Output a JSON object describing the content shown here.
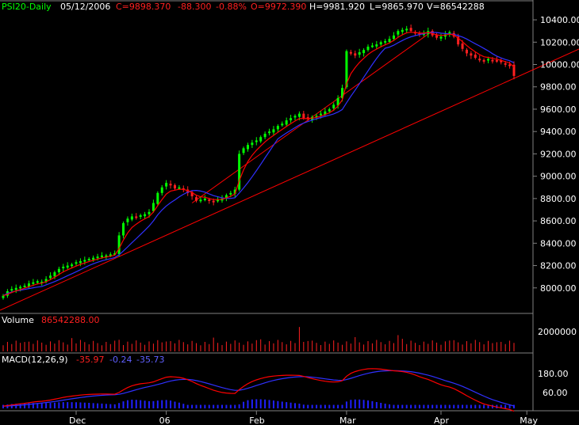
{
  "header": {
    "symbol": "PSI20-Daily",
    "date": "05/12/2006",
    "close": "C=9898.370",
    "change": "-88.300",
    "change_pct": "-0.88%",
    "open": "O=9972.390",
    "high": "H=9981.920",
    "low": "L=9865.970",
    "volume": "V=86542288"
  },
  "volume_panel": {
    "label": "Volume",
    "value": "86542288.00",
    "tick": "2000000"
  },
  "macd_panel": {
    "label": "MACD(12,26,9)",
    "v1": "-35.97",
    "v2": "-0.24",
    "v3": "-35.73",
    "ticks": [
      "180.00",
      "60.00"
    ]
  },
  "colors": {
    "up": "#00ff00",
    "down": "#ff2020",
    "ma_fast": "#ff0000",
    "ma_slow": "#3030ff",
    "trend": "#ff0000",
    "text": "#ffffff",
    "label_green": "#00ff00",
    "label_red": "#ff2020",
    "label_blue": "#6060ff",
    "volume": "#ff2020",
    "hist": "#2020ff"
  },
  "chart_data": {
    "type": "candlestick",
    "price_axis": {
      "ylim": [
        7800,
        10450
      ],
      "ticks": [
        "10400.00",
        "10200.00",
        "10000.00",
        "9800.00",
        "9600.00",
        "9400.00",
        "9200.00",
        "9000.00",
        "8800.00",
        "8600.00",
        "8400.00",
        "8200.00",
        "8000.00"
      ]
    },
    "x_ticks": [
      "Dec",
      "06",
      "Feb",
      "Mar",
      "Apr",
      "May"
    ],
    "x_tick_index": [
      17,
      38,
      59,
      80,
      102,
      122
    ],
    "closes": [
      7930,
      7970,
      7990,
      8000,
      8010,
      8020,
      8040,
      8050,
      8060,
      8055,
      8080,
      8110,
      8140,
      8170,
      8190,
      8200,
      8210,
      8230,
      8240,
      8250,
      8260,
      8270,
      8280,
      8290,
      8290,
      8300,
      8310,
      8470,
      8580,
      8620,
      8640,
      8630,
      8650,
      8660,
      8680,
      8760,
      8850,
      8900,
      8940,
      8920,
      8890,
      8900,
      8880,
      8850,
      8820,
      8780,
      8790,
      8800,
      8780,
      8770,
      8790,
      8800,
      8830,
      8850,
      8880,
      9200,
      9250,
      9280,
      9300,
      9320,
      9350,
      9380,
      9400,
      9420,
      9450,
      9470,
      9500,
      9520,
      9540,
      9560,
      9520,
      9510,
      9530,
      9540,
      9560,
      9580,
      9600,
      9640,
      9700,
      9790,
      10120,
      10100,
      10080,
      10110,
      10130,
      10160,
      10170,
      10180,
      10200,
      10210,
      10230,
      10260,
      10300,
      10310,
      10320,
      10300,
      10280,
      10270,
      10280,
      10300,
      10260,
      10240,
      10250,
      10270,
      10290,
      10250,
      10180,
      10140,
      10100,
      10080,
      10060,
      10040,
      10030,
      10050,
      10040,
      10030,
      10020,
      10000,
      9990,
      9898
    ],
    "volume": {
      "ylim": [
        0,
        140000000
      ]
    },
    "macd": {
      "ylim": [
        -15,
        255
      ]
    }
  }
}
